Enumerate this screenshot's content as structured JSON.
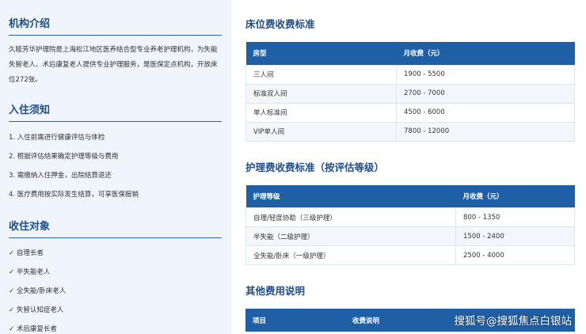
{
  "intro": {
    "title": "机构介绍",
    "paragraph": "久睦芳华护理院是上海松江地区医养结合型专业养老护理机构，为失能失智老人、术后康复老人提供专业护理服务，是医保定点机构，开放床位272张。"
  },
  "admission": {
    "title": "入住须知",
    "items": [
      "1. 入住前需进行健康评估与体检",
      "2. 根据评估结果确定护理等级与费用",
      "3. 需缴纳入住押金，出院结算退还",
      "4. 医疗费用按实际发生结算，可享医保报销"
    ]
  },
  "targets": {
    "title": "收住对象",
    "items": [
      "✓ 自理长者",
      "✓ 半失能老人",
      "✓ 全失能/卧床老人",
      "✓ 失智认知症老人",
      "✓ 术后康复长者"
    ]
  },
  "bed_fees": {
    "title": "床位费收费标准",
    "headers": [
      "房型",
      "月收费（元）"
    ],
    "rows": [
      [
        "三人间",
        "1900 - 5500"
      ],
      [
        "标准双人间",
        "2700 - 7000"
      ],
      [
        "单人标准间",
        "4500 - 6000"
      ],
      [
        "VIP单人间",
        "7800 - 12000"
      ]
    ]
  },
  "care_fees": {
    "title": "护理费收费标准（按评估等级）",
    "headers": [
      "护理等级",
      "月收费（元）"
    ],
    "rows": [
      [
        "自理/轻度协助（三级护理）",
        "800 - 1350"
      ],
      [
        "半失能（二级护理）",
        "1500 - 2400"
      ],
      [
        "全失能/卧床（一级护理）",
        "2500 - 4000"
      ]
    ]
  },
  "other_fees": {
    "title": "其他费用说明",
    "headers": [
      "项目",
      "收费说明"
    ]
  },
  "watermark": "搜狐号@搜狐焦点白银站",
  "colors": {
    "accent": "#1f4e8c",
    "header_bg": "#1f5fa6",
    "left_bg": "#f0f5fb",
    "row_alt": "#f3f7fc"
  }
}
